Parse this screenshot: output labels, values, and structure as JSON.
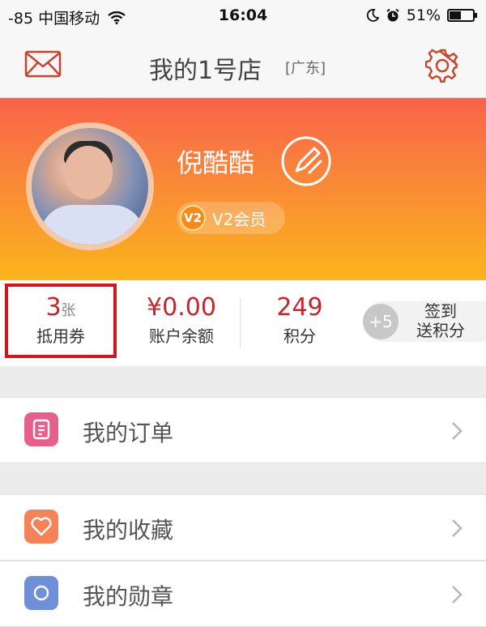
{
  "status_bar": {
    "carrier": "-85 中国移动",
    "time": "16:04",
    "battery": "51%",
    "battery_level": 0.51
  },
  "navbar": {
    "title": "我的1号店",
    "region": "[广东]",
    "left_icon": "mail-icon",
    "right_icon": "gear-icon"
  },
  "profile": {
    "username": "倪酷酷",
    "vip_badge": "V2",
    "vip_label": "V2会员",
    "colors": {
      "gradient_top": "#f9624a",
      "gradient_bottom": "#fbb41c"
    }
  },
  "stats": {
    "coupons": {
      "value": "3",
      "unit": "张",
      "label": "抵用券"
    },
    "balance": {
      "value": "¥0.00",
      "label": "账户余额"
    },
    "points": {
      "value": "249",
      "label": "积分"
    },
    "checkin": {
      "bonus": "+5",
      "line1": "签到",
      "line2": "送积分"
    },
    "accent_color": "#c0282d",
    "highlight_color": "#d4151b"
  },
  "menu": {
    "items": [
      {
        "label": "我的订单",
        "icon": "order-icon",
        "color": "#e8608a"
      },
      {
        "label": "我的收藏",
        "icon": "heart-icon",
        "color": "#f4835a"
      },
      {
        "label": "我的勋章",
        "icon": "medal-icon",
        "color": "#6f8fd8"
      }
    ]
  }
}
